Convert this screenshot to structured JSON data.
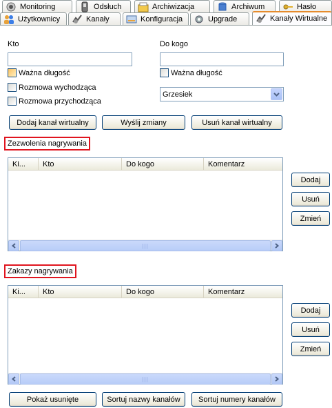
{
  "tabs": {
    "row1": [
      "Monitoring",
      "Odsłuch",
      "Archiwizacja",
      "Archiwum",
      "Hasło"
    ],
    "row2": [
      "Użytkownicy",
      "Kanały",
      "Konfiguracja",
      "Upgrade",
      "Kanały Wirtualne"
    ]
  },
  "form": {
    "kto_label": "Kto",
    "do_kogo_label": "Do kogo",
    "kto_value": "",
    "do_kogo_value": "",
    "wazna_dlugosc_left": "Ważna długość",
    "rozmowa_wychodzaca": "Rozmowa wychodząca",
    "rozmowa_przychodzaca": "Rozmowa przychodząca",
    "wazna_dlugosc_right": "Ważna długość",
    "select_value": "Grzesiek"
  },
  "actions": {
    "dodaj_kanal": "Dodaj kanał wirtualny",
    "wyslij_zmiany": "Wyślij zmiany",
    "usun_kanal": "Usuń kanał wirtualny"
  },
  "permissions": {
    "title": "Zezwolenia nagrywania",
    "columns": [
      "Ki...",
      "Kto",
      "Do kogo",
      "Komentarz"
    ],
    "rows": [],
    "add": "Dodaj",
    "remove": "Usuń",
    "edit": "Zmień"
  },
  "bans": {
    "title": "Zakazy nagrywania",
    "columns": [
      "Ki...",
      "Kto",
      "Do kogo",
      "Komentarz"
    ],
    "rows": [],
    "add": "Dodaj",
    "remove": "Usuń",
    "edit": "Zmień"
  },
  "bottom": {
    "pokaz_usuniete": "Pokaż usunięte",
    "sortuj_nazwy": "Sortuj nazwy kanałów",
    "sortuj_numery": "Sortuj numery kanałów"
  },
  "icons": {
    "monitoring": "monitoring-icon",
    "odsluch": "phone-icon",
    "archiwizacja": "archive-box-icon",
    "archiwum": "archive-drum-icon",
    "haslo": "key-icon",
    "uzytkownicy": "users-icon",
    "kanaly": "channels-icon",
    "konfiguracja": "config-icon",
    "upgrade": "gear-icon",
    "kanaly_wirtualne": "virtual-channels-icon"
  }
}
